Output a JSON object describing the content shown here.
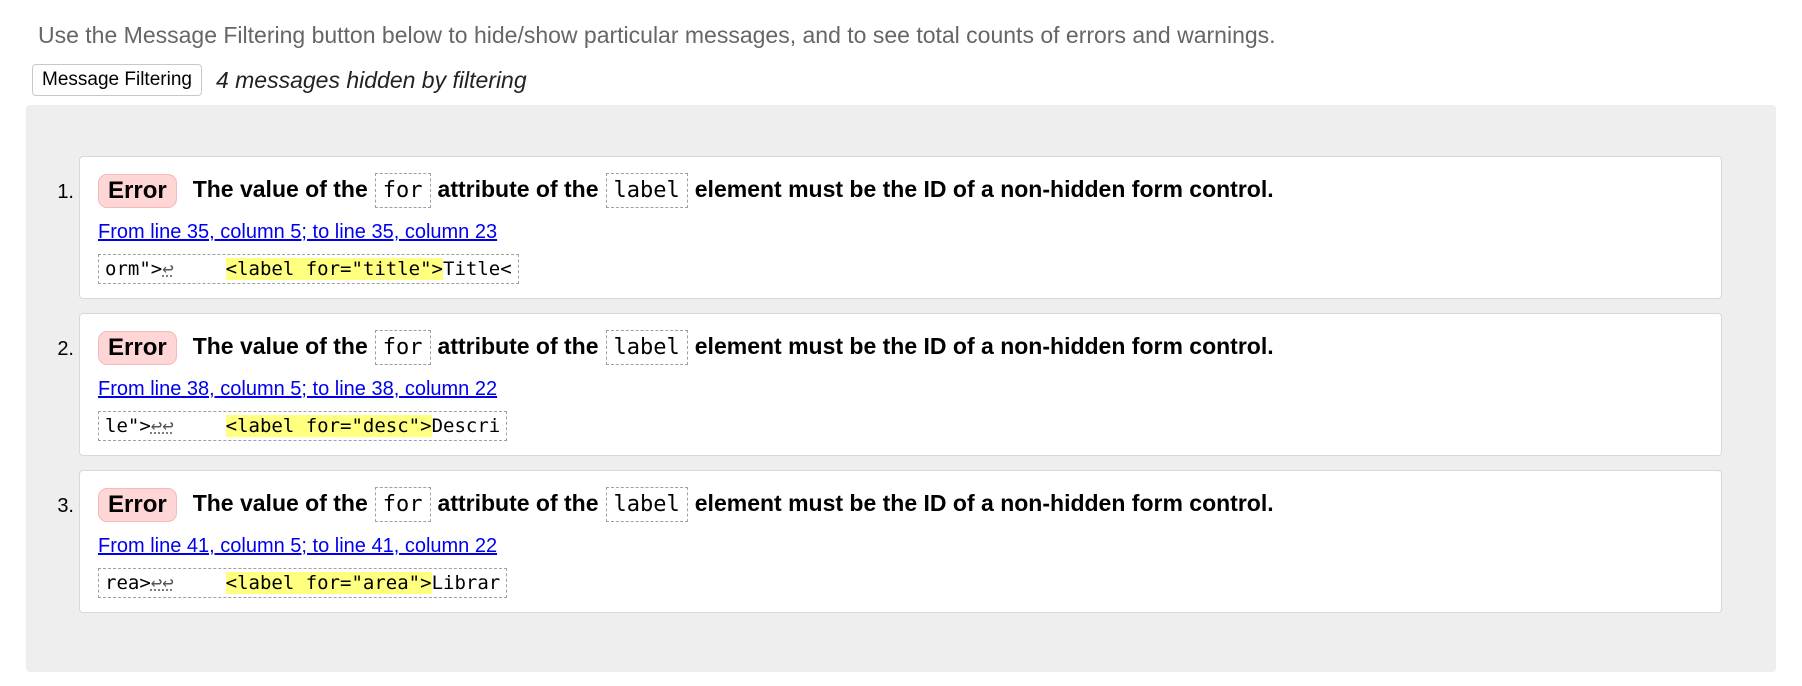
{
  "intro_text": "Use the Message Filtering button below to hide/show particular messages, and to see total counts of errors and warnings.",
  "filter": {
    "button_label": "Message Filtering",
    "status": "4 messages hidden by filtering"
  },
  "messages": [
    {
      "number": "1.",
      "type": "Error",
      "text_1": "The value of the",
      "code_1": "for",
      "text_2": "attribute of the",
      "code_2": "label",
      "text_3": "element must be the ID of a non-hidden form control.",
      "location": "From line 35, column 5; to line 35, column 23",
      "extract_before": "orm\">",
      "extract_lf": "↩",
      "extract_highlight": "<label for=\"title\">",
      "extract_after": "Title<"
    },
    {
      "number": "2.",
      "type": "Error",
      "text_1": "The value of the",
      "code_1": "for",
      "text_2": "attribute of the",
      "code_2": "label",
      "text_3": "element must be the ID of a non-hidden form control.",
      "location": "From line 38, column 5; to line 38, column 22",
      "extract_before": "le\">",
      "extract_lf": "↩↩",
      "extract_highlight": "<label for=\"desc\">",
      "extract_after": "Descri"
    },
    {
      "number": "3.",
      "type": "Error",
      "text_1": "The value of the",
      "code_1": "for",
      "text_2": "attribute of the",
      "code_2": "label",
      "text_3": "element must be the ID of a non-hidden form control.",
      "location": "From line 41, column 5; to line 41, column 22",
      "extract_before": "rea>",
      "extract_lf": "↩↩",
      "extract_highlight": "<label for=\"area\">",
      "extract_after": "Librar"
    }
  ],
  "colors": {
    "error_badge_bg": "#ffd6d6",
    "highlight": "#ffff80",
    "link": "#0000ee",
    "panel_bg": "#eeeeee"
  }
}
